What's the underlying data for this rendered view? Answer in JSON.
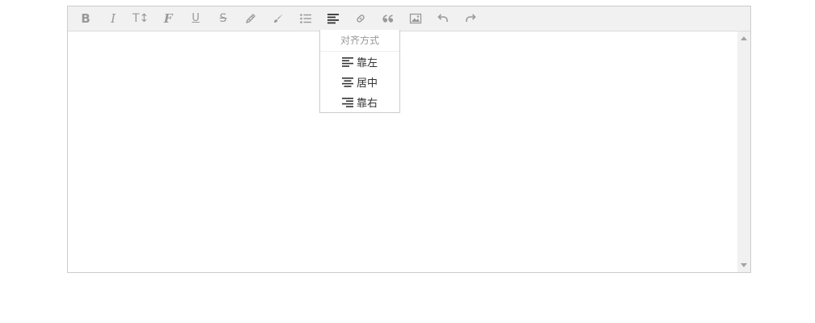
{
  "toolbar": {
    "buttons": [
      {
        "name": "bold-button",
        "icon": "bold-icon",
        "glyph": "B"
      },
      {
        "name": "italic-button",
        "icon": "italic-icon",
        "glyph": "I"
      },
      {
        "name": "font-size-button",
        "icon": "font-size-icon",
        "glyph": "T↕"
      },
      {
        "name": "font-family-button",
        "icon": "font-family-icon",
        "glyph": "F"
      },
      {
        "name": "underline-button",
        "icon": "underline-icon",
        "glyph": "U"
      },
      {
        "name": "strikethrough-button",
        "icon": "strikethrough-icon",
        "glyph": "S"
      },
      {
        "name": "highlight-button",
        "icon": "pencil-icon"
      },
      {
        "name": "text-color-button",
        "icon": "brush-icon"
      },
      {
        "name": "list-button",
        "icon": "list-icon"
      },
      {
        "name": "align-button",
        "icon": "align-left-icon",
        "active": true
      },
      {
        "name": "link-button",
        "icon": "link-icon"
      },
      {
        "name": "quote-button",
        "icon": "quote-icon"
      },
      {
        "name": "image-button",
        "icon": "image-icon"
      },
      {
        "name": "undo-button",
        "icon": "undo-icon"
      },
      {
        "name": "redo-button",
        "icon": "redo-icon"
      }
    ]
  },
  "align_menu": {
    "title": "对齐方式",
    "items": [
      {
        "label": "靠左",
        "icon": "align-left-icon"
      },
      {
        "label": "居中",
        "icon": "align-center-icon"
      },
      {
        "label": "靠右",
        "icon": "align-right-icon"
      }
    ]
  },
  "colors": {
    "toolbar_bg": "#f1f1f1",
    "icon_default": "#999999",
    "icon_active": "#333333",
    "border": "#cccccc"
  }
}
